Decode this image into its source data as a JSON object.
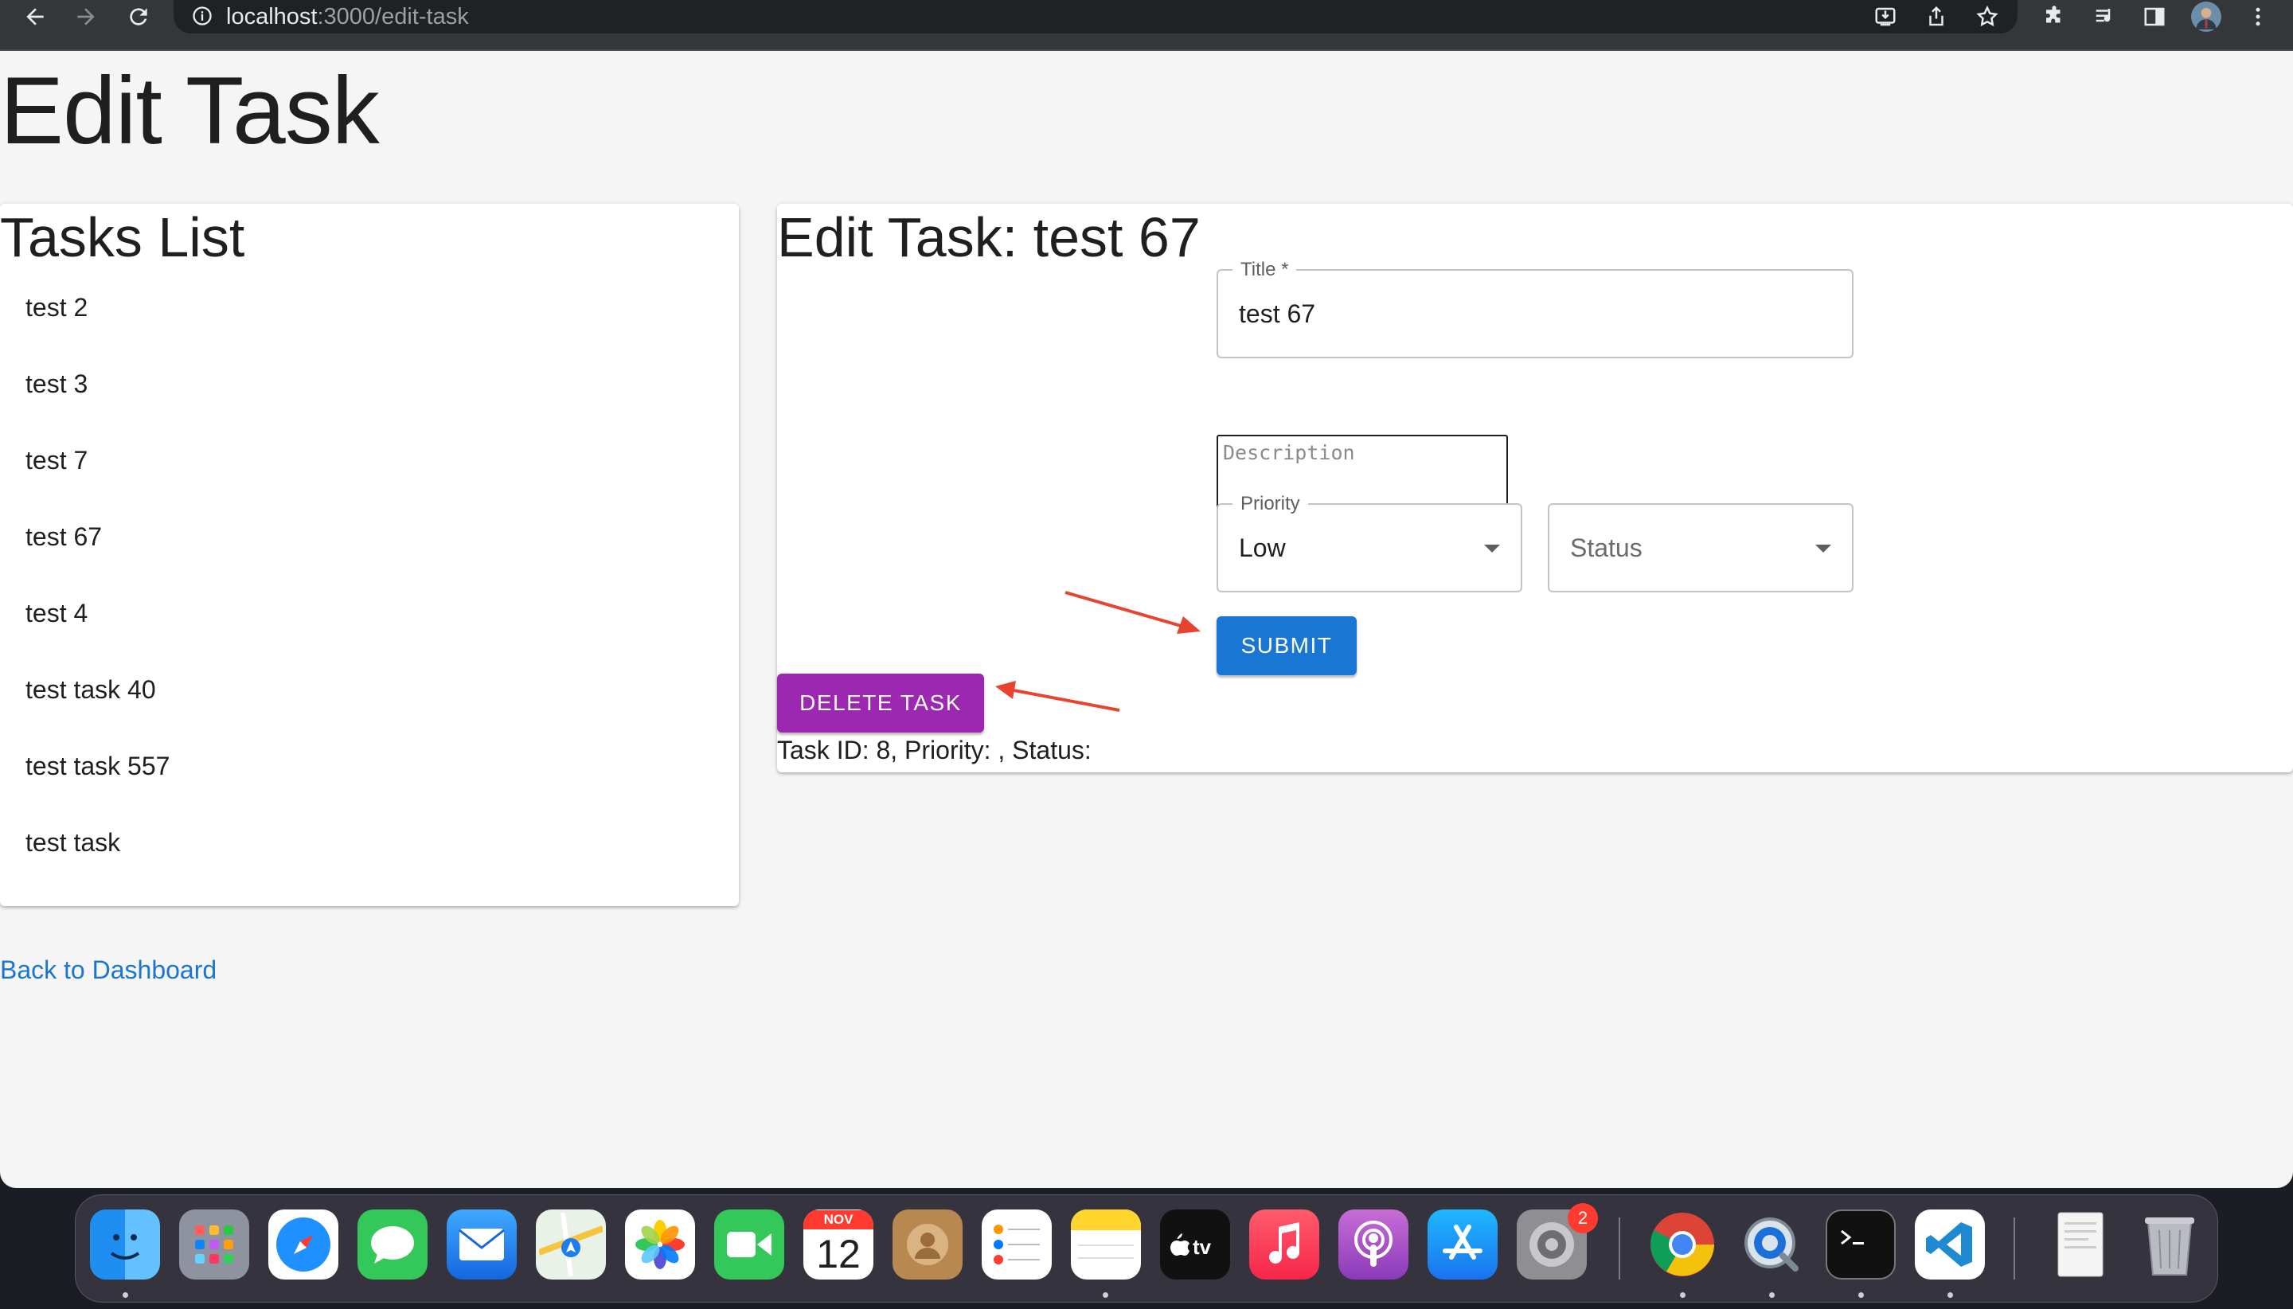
{
  "browser": {
    "url_host": "localhost",
    "url_path": ":3000/edit-task"
  },
  "page": {
    "heading": "Edit Task",
    "back_link": "Back to Dashboard"
  },
  "tasks_panel": {
    "title": "Tasks List",
    "items": [
      "test 2",
      "test 3",
      "test 7",
      "test 67",
      "test 4",
      "test task 40",
      "test task 557",
      "test task"
    ]
  },
  "edit_panel": {
    "title": "Edit Task: test 67",
    "title_field": {
      "label": "Title",
      "required_mark": "*",
      "value": "test 67"
    },
    "description_field": {
      "placeholder": "Description",
      "value": ""
    },
    "priority_field": {
      "label": "Priority",
      "value": "Low"
    },
    "status_field": {
      "label": "Status",
      "value": ""
    },
    "submit_label": "SUBMIT",
    "delete_label": "DELETE TASK",
    "info": "Task ID: 8, Priority: , Status:"
  },
  "dock": {
    "calendar_month": "NOV",
    "calendar_day": "12",
    "settings_badge": "2",
    "items": [
      "finder-icon",
      "launchpad-icon",
      "safari-icon",
      "messages-icon",
      "mail-icon",
      "maps-icon",
      "photos-icon",
      "facetime-icon",
      "calendar-icon",
      "contacts-icon",
      "reminders-icon",
      "notes-icon",
      "apple-tv-icon",
      "music-icon",
      "podcasts-icon",
      "app-store-icon",
      "system-settings-icon",
      "chrome-icon",
      "quicktime-icon",
      "terminal-icon",
      "vscode-icon",
      "pdf-document-icon",
      "trash-icon"
    ]
  },
  "colors": {
    "primary": "#1976d2",
    "secondary": "#9c27b0",
    "annotation_arrow": "#e8432f"
  }
}
